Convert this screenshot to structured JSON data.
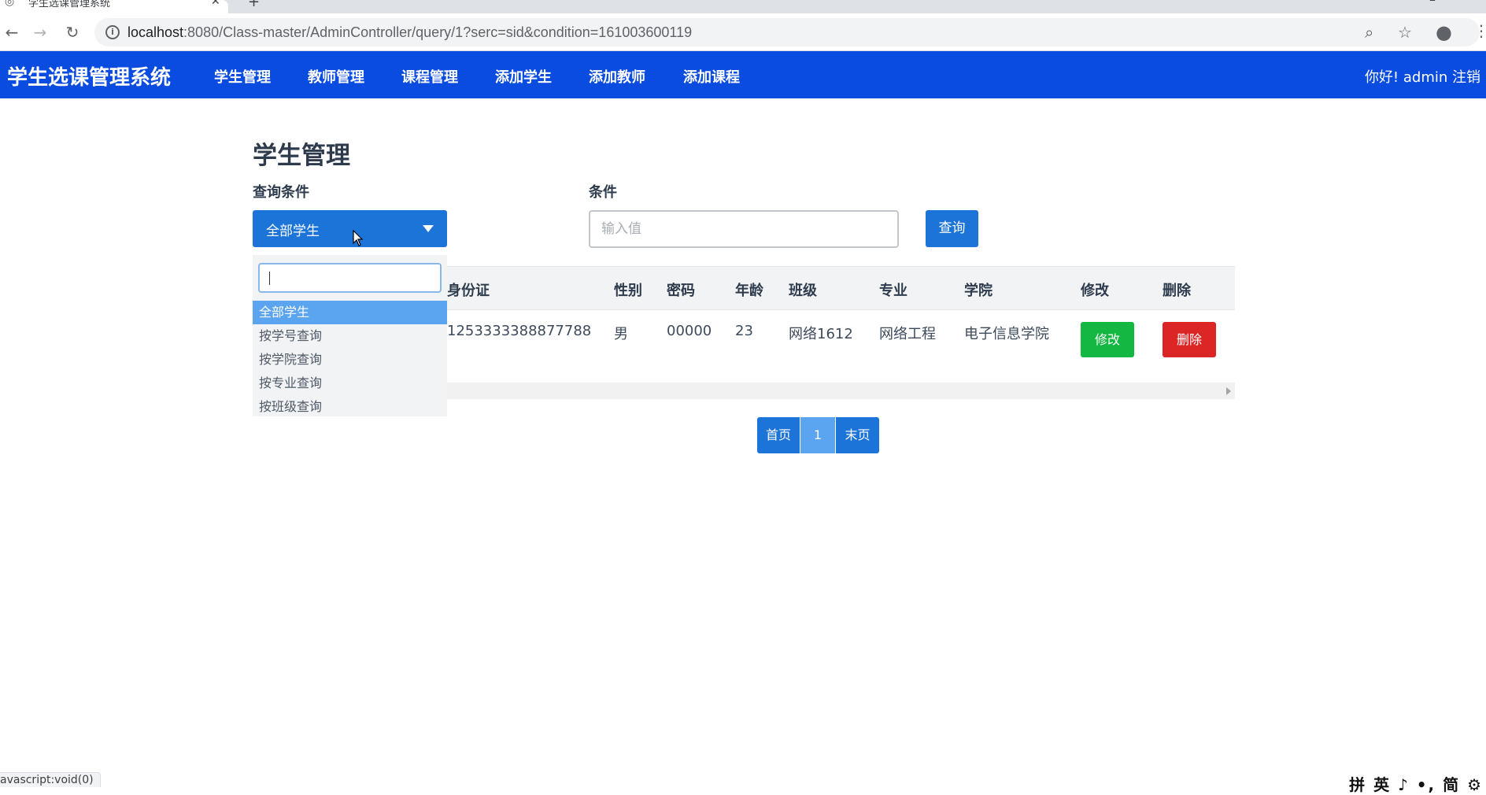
{
  "browser": {
    "tab_title": "学生选课管理系统",
    "url_host": "localhost",
    "url_rest": ":8080/Class-master/AdminController/query/1?serc=sid&condition=161003600119",
    "status_text": "avascript:void(0)"
  },
  "navbar": {
    "brand": "学生选课管理系统",
    "links": [
      "学生管理",
      "教师管理",
      "课程管理",
      "添加学生",
      "添加教师",
      "添加课程"
    ],
    "user_text": "你好!  admin 注销"
  },
  "main": {
    "title": "学生管理",
    "query_label": "查询条件",
    "condition_label": "条件",
    "select_value": "全部学生",
    "input_placeholder": "输入值",
    "query_button": "查询"
  },
  "dropdown": {
    "options": [
      "全部学生",
      "按学号查询",
      "按学院查询",
      "按专业查询",
      "按班级查询"
    ]
  },
  "table": {
    "headers": [
      "身份证",
      "性别",
      "密码",
      "年龄",
      "班级",
      "专业",
      "学院",
      "修改",
      "删除"
    ],
    "rows": [
      {
        "idcard": "1253333388877788",
        "gender": "男",
        "password": "00000",
        "age": "23",
        "class": "网络1612",
        "major": "网络工程",
        "college": "电子信息学院",
        "edit_label": "修改",
        "delete_label": "删除"
      }
    ]
  },
  "pagination": {
    "first": "首页",
    "current": "1",
    "last": "末页"
  },
  "ime": "拼 英 ♪ •, 简 ⚙",
  "colors": {
    "navbar": "#0a4be0",
    "primary": "#1d74d8",
    "active_option": "#5aa4f0",
    "success": "#13b741",
    "danger": "#dc2626"
  }
}
